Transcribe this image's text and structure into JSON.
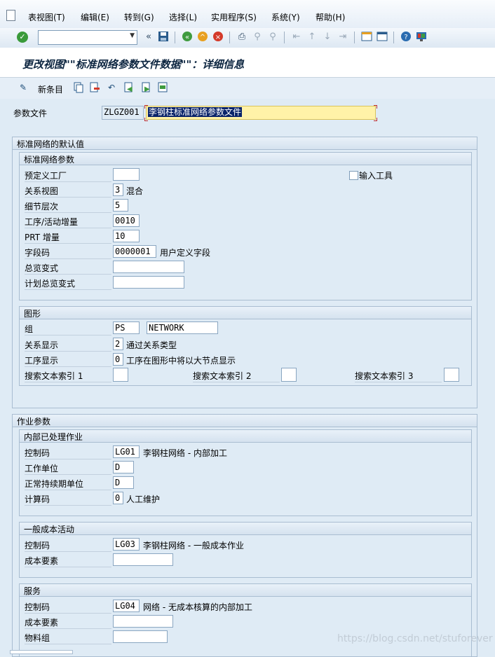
{
  "menu": [
    "表视图(T)",
    "编辑(E)",
    "转到(G)",
    "选择(L)",
    "实用程序(S)",
    "系统(Y)",
    "帮助(H)"
  ],
  "toolbar": {
    "command_value": "",
    "icons": [
      "enter-icon",
      "back-icon",
      "save-icon",
      "back-green-icon",
      "exit-icon",
      "cancel-icon",
      "print-icon",
      "find-icon",
      "find-next-icon",
      "first-page-icon",
      "previous-page-icon",
      "next-page-icon",
      "last-page-icon",
      "create-session-icon",
      "shortcut-icon",
      "help-icon",
      "customize-layout-icon"
    ]
  },
  "title": "更改视图\"\"标准网络参数文件数据\"\"：详细信息",
  "app_toolbar": {
    "new_entries": "新条目"
  },
  "profile": {
    "label": "参数文件",
    "value": "ZLGZ001",
    "description": "李钢柱标准网络参数文件"
  },
  "defaults_frame": {
    "title": "标准网络的默认值",
    "std_params": {
      "title": "标准网络参数",
      "plant_label": "预定义工厂",
      "plant_value": "",
      "input_tool_label": "输入工具",
      "input_tool_checked": false,
      "relview_label": "关系视图",
      "relview_value": "3",
      "relview_text": "混合",
      "detail_label": "细节层次",
      "detail_value": "5",
      "op_incr_label": "工序/活动增量",
      "op_incr_value": "0010",
      "prt_label": "PRT 增量",
      "prt_value": "10",
      "field_key_label": "字段码",
      "field_key_value": "0000001",
      "field_key_text": "用户定义字段",
      "overview_label": "总览变式",
      "overview_value": "",
      "plan_overview_label": "计划总览变式",
      "plan_overview_value": ""
    },
    "graphics": {
      "title": "图形",
      "group_label": "组",
      "group_value": "PS",
      "group_value2": "NETWORK",
      "rel_disp_label": "关系显示",
      "rel_disp_value": "2",
      "rel_disp_text": "通过关系类型",
      "op_disp_label": "工序显示",
      "op_disp_value": "0",
      "op_disp_text": "工序在图形中将以大节点显示",
      "search1_label": "搜索文本索引 1",
      "search1_value": "",
      "search2_label": "搜索文本索引 2",
      "search2_value": "",
      "search3_label": "搜索文本索引 3",
      "search3_value": ""
    }
  },
  "activity_frame": {
    "title": "作业参数",
    "internal": {
      "title": "内部已处理作业",
      "ctrl_label": "控制码",
      "ctrl_value": "LG01",
      "ctrl_text": "李钢柱网络 - 内部加工",
      "unit_label": "工作单位",
      "unit_value": "D",
      "dur_label": "正常持续期单位",
      "dur_value": "D",
      "calc_label": "计算码",
      "calc_value": "0",
      "calc_text": "人工维护"
    },
    "general_cost": {
      "title": "一般成本活动",
      "ctrl_label": "控制码",
      "ctrl_value": "LG03",
      "ctrl_text": "李钢柱网络 - 一般成本作业",
      "cost_elem_label": "成本要素",
      "cost_elem_value": ""
    },
    "service": {
      "title": "服务",
      "ctrl_label": "控制码",
      "ctrl_value": "LG04",
      "ctrl_text": "网络 - 无成本核算的内部加工",
      "cost_elem_label": "成本要素",
      "cost_elem_value": "",
      "matgrp_label": "物料组",
      "matgrp_value": ""
    }
  },
  "watermark": "https://blog.csdn.net/stuforever"
}
